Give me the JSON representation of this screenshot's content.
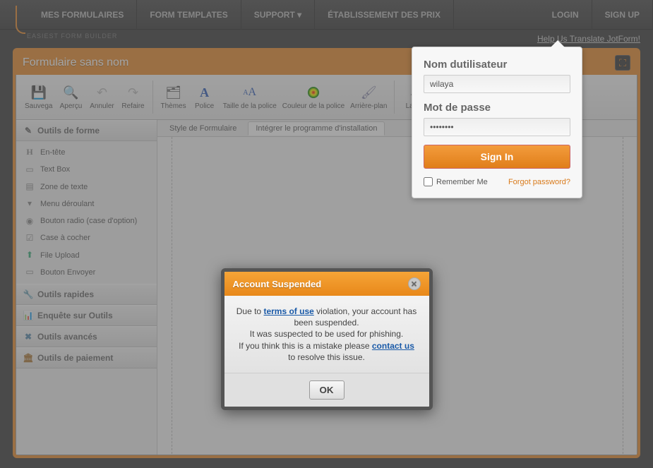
{
  "nav": {
    "items": [
      "MES FORMULAIRES",
      "FORM TEMPLATES",
      "SUPPORT ▾",
      "ÉTABLISSEMENT DES PRIX"
    ],
    "right": [
      "LOGIN",
      "SIGN UP"
    ],
    "translate": "Help Us Translate JotForm!",
    "tagline": "EASIEST FORM BUILDER"
  },
  "app": {
    "title": "Formulaire sans nom"
  },
  "toolbar": {
    "save": "Sauvega",
    "preview": "Aperçu",
    "undo": "Annuler",
    "redo": "Refaire",
    "themes": "Thèmes",
    "font": "Police",
    "fontsize": "Taille de la police",
    "fontcolor": "Couleur de la police",
    "background": "Arrière-plan",
    "formwidth": "La for"
  },
  "sidebar": {
    "sections": {
      "form_tools": "Outils de forme",
      "quick_tools": "Outils rapides",
      "survey_tools": "Enquête sur Outils",
      "advanced_tools": "Outils avancés",
      "payment_tools": "Outils de paiement"
    },
    "form_items": [
      "En-tête",
      "Text Box",
      "Zone de texte",
      "Menu déroulant",
      "Bouton radio (case d'option)",
      "Case à cocher",
      "File Upload",
      "Bouton Envoyer"
    ]
  },
  "tabs": {
    "style": "Style de Formulaire",
    "embed": "Intégrer le programme d'installation"
  },
  "login": {
    "username_label": "Nom dutilisateur",
    "username_value": "wilaya",
    "password_label": "Mot de passe",
    "password_value": "••••••••",
    "signin": "Sign In",
    "remember": "Remember Me",
    "forgot": "Forgot password?"
  },
  "modal": {
    "title": "Account Suspended",
    "line1a": "Due to ",
    "terms_link": "terms of use",
    "line1b": " violation, your account has been suspended.",
    "line2": "It was suspected to be used for phishing.",
    "line3a": "If you think this is a mistake please ",
    "contact_link": "contact us",
    "line3b": " to resolve this issue.",
    "ok": "OK"
  }
}
